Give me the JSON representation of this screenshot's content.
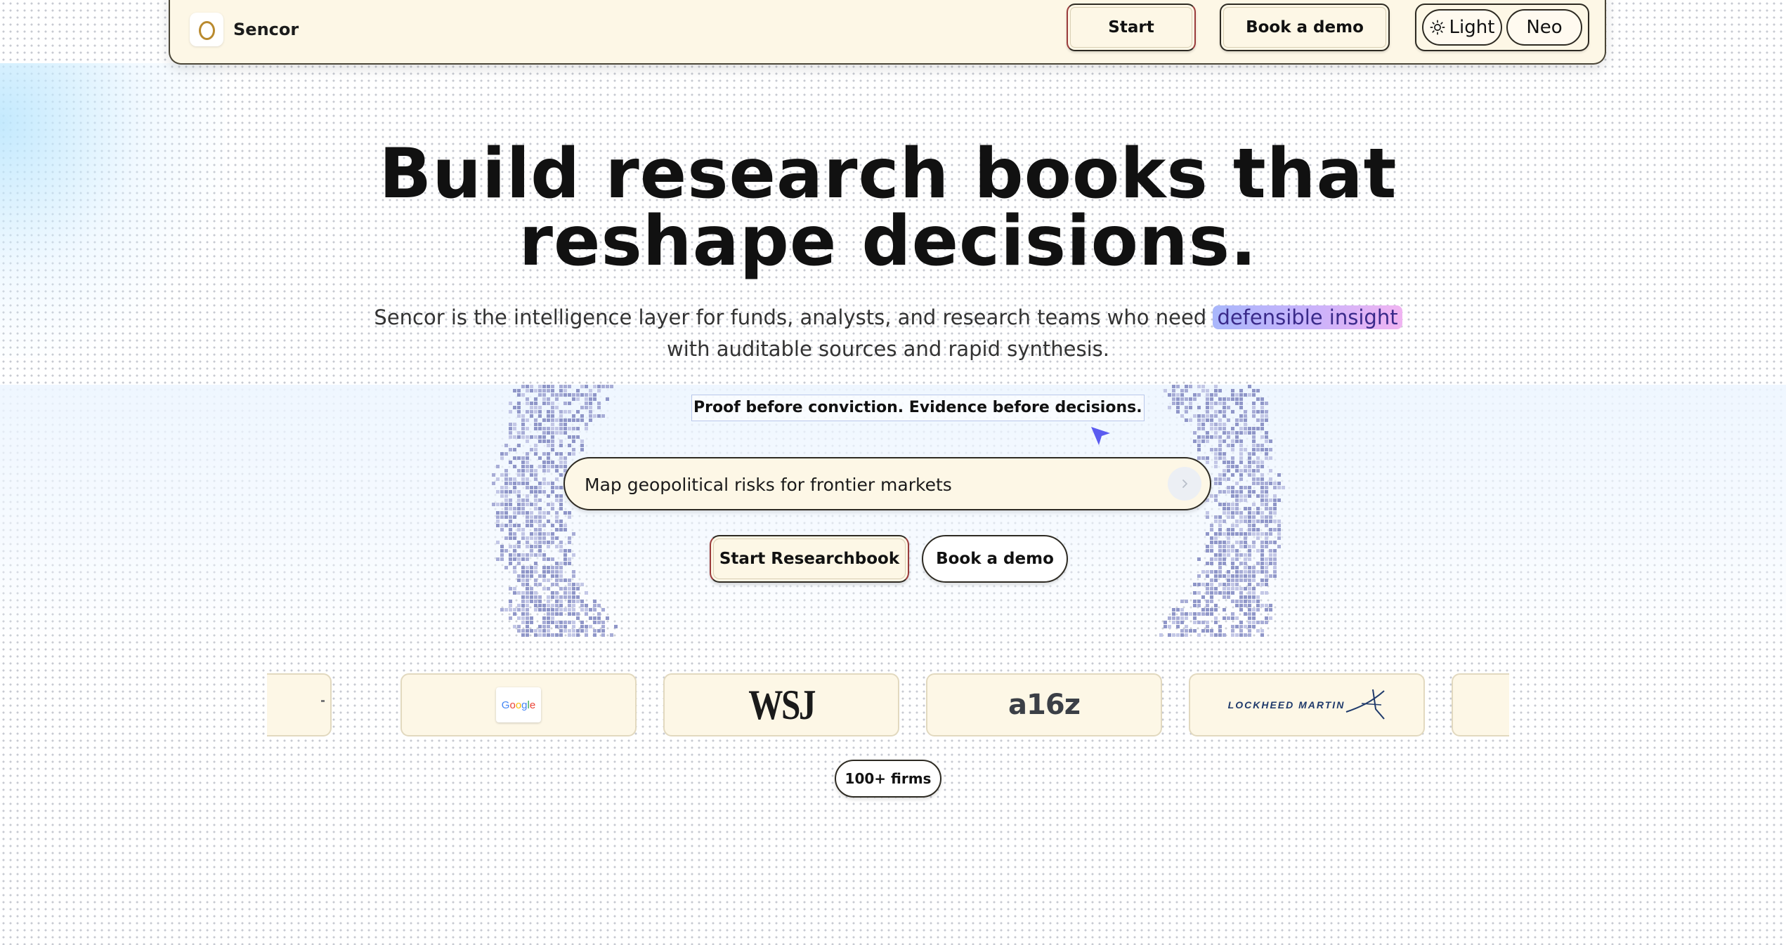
{
  "nav": {
    "brand": "Sencor",
    "start_label": "Start",
    "demo_label": "Book a demo",
    "theme_light": "Light",
    "theme_neo": "Neo"
  },
  "hero": {
    "title_line1": "Build research books that",
    "title_line2": "reshape decisions.",
    "subtitle_pre": "Sencor is the intelligence layer for funds, analysts, and research teams who need ",
    "subtitle_highlight": "defensible insight",
    "subtitle_post": " with auditable sources and rapid synthesis.",
    "tagline": "Proof before conviction. Evidence before decisions."
  },
  "search": {
    "value": "Map geopolitical risks for frontier markets"
  },
  "cta": {
    "primary": "Start Researchbook",
    "secondary": "Book a demo"
  },
  "logos": {
    "google": "Google",
    "wsj": "WSJ",
    "a16z": "a16z",
    "lockheed": "LOCKHEED MARTIN",
    "firms_count": "100+ firms"
  },
  "colors": {
    "cream": "#fdf7e6",
    "ink": "#111111",
    "accent": "#5b5bf0",
    "highlight_start": "#a9b7fb",
    "highlight_end": "#f0b4f2"
  },
  "icons": {
    "logo": "ring-logo-icon",
    "theme": "sun-icon",
    "send": "chevron-right-icon",
    "cursor": "cursor-arrow-icon"
  }
}
